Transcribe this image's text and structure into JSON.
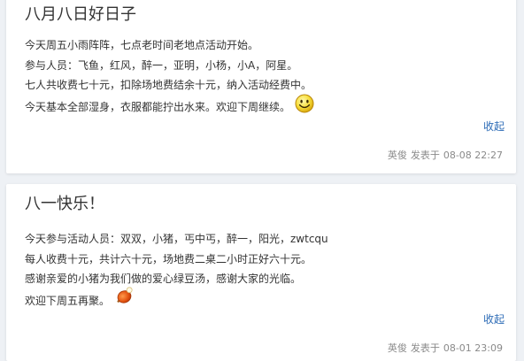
{
  "posts": [
    {
      "title": "八月八日好日子",
      "lines": [
        "今天周五小雨阵阵，七点老时间老地点活动开始。",
        "参与人员：飞鱼，红风，醉一，亚明，小杨，小A，阿星。",
        "七人共收费七十元，扣除场地费结余十元，纳入活动经费中。",
        "今天基本全部湿身，衣服都能拧出水来。欢迎下周继续。"
      ],
      "emoji": "smile-icon",
      "collapse_label": "收起",
      "author": "英俊",
      "posted_label": "发表于",
      "date": "08-08 22:27"
    },
    {
      "title": "八一快乐！",
      "lines": [
        "今天参与活动人员：双双，小猪，丐中丐，醉一，阳光，zwtcqu",
        "每人收费十元，共计六十元，场地费二桌二小时正好六十元。",
        "感谢亲爱的小猪为我们做的爱心绿豆汤，感谢大家的光临。",
        "欢迎下周五再聚。"
      ],
      "emoji": "pingpong-icon",
      "collapse_label": "收起",
      "author": "英俊",
      "posted_label": "发表于",
      "date": "08-01 23:09"
    }
  ],
  "colors": {
    "page_bg": "#eef1f5",
    "card_bg": "#ffffff",
    "text": "#333333",
    "link": "#2c6bb6",
    "meta": "#8a8a8a"
  }
}
